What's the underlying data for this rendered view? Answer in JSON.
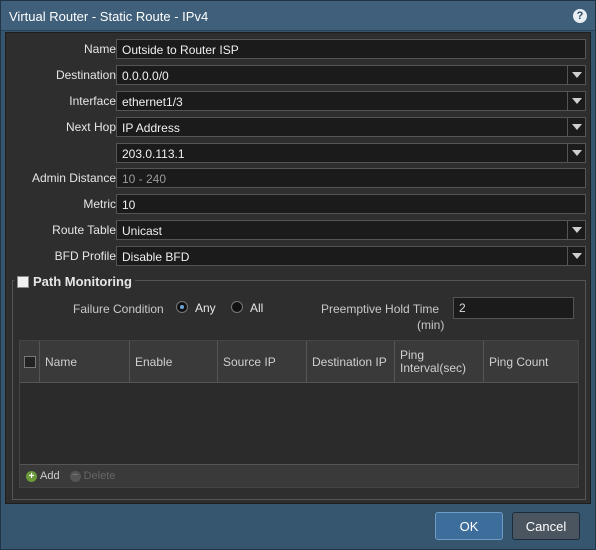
{
  "window": {
    "title": "Virtual Router - Static Route - IPv4",
    "help_icon": "?"
  },
  "fields": {
    "name": {
      "label": "Name",
      "value": "Outside to Router ISP"
    },
    "destination": {
      "label": "Destination",
      "value": "0.0.0.0/0"
    },
    "interface": {
      "label": "Interface",
      "value": "ethernet1/3"
    },
    "next_hop": {
      "label": "Next Hop",
      "value": "IP Address"
    },
    "next_hop_ip": {
      "value": "203.0.113.1"
    },
    "admin_distance": {
      "label": "Admin Distance",
      "placeholder": "10 - 240"
    },
    "metric": {
      "label": "Metric",
      "value": "10"
    },
    "route_table": {
      "label": "Route Table",
      "value": "Unicast"
    },
    "bfd_profile": {
      "label": "BFD Profile",
      "value": "Disable BFD"
    }
  },
  "path_monitoring": {
    "label": "Path Monitoring",
    "enabled": false,
    "failure_condition": {
      "label": "Failure Condition",
      "options": [
        "Any",
        "All"
      ],
      "selected": "Any"
    },
    "preemptive_hold": {
      "label_line1": "Preemptive Hold Time",
      "label_line2": "(min)",
      "value": "2"
    },
    "table": {
      "columns": [
        "Name",
        "Enable",
        "Source IP",
        "Destination IP",
        "Ping Interval(sec)",
        "Ping Count"
      ],
      "rows": []
    },
    "add_label": "Add",
    "delete_label": "Delete"
  },
  "buttons": {
    "ok": "OK",
    "cancel": "Cancel"
  }
}
